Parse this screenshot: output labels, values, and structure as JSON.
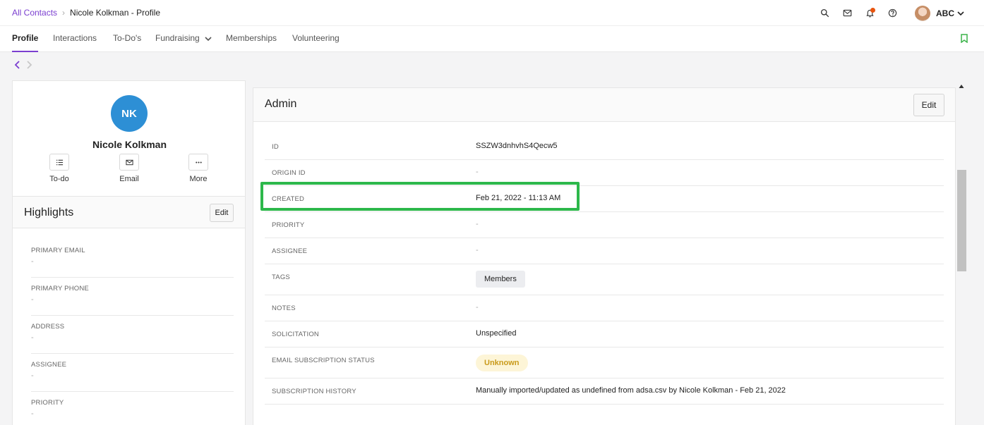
{
  "breadcrumb": {
    "parent": "All Contacts",
    "current": "Nicole Kolkman - Profile"
  },
  "header": {
    "account_label": "ABC",
    "icons": [
      "search-icon",
      "mail-icon",
      "bell-icon",
      "help-icon",
      "avatar",
      "chevron-down-icon"
    ],
    "notification_color": "#e8540e"
  },
  "tabs": [
    {
      "label": "Profile",
      "active": true
    },
    {
      "label": "Interactions"
    },
    {
      "label": "To-Do's"
    },
    {
      "label": "Fundraising"
    },
    {
      "label": "Memberships"
    },
    {
      "label": "Volunteering"
    }
  ],
  "contact": {
    "initials": "NK",
    "name": "Nicole Kolkman",
    "avatar_color": "#2d8fd5",
    "actions": [
      {
        "label": "To-do",
        "icon": "todo-list-icon"
      },
      {
        "label": "Email",
        "icon": "mail-icon"
      },
      {
        "label": "More",
        "icon": "more-icon"
      }
    ]
  },
  "highlights": {
    "title": "Highlights",
    "edit_label": "Edit",
    "fields": [
      {
        "label": "PRIMARY EMAIL",
        "value": "-"
      },
      {
        "label": "PRIMARY PHONE",
        "value": "-"
      },
      {
        "label": "ADDRESS",
        "value": "-"
      },
      {
        "label": "ASSIGNEE",
        "value": "-"
      },
      {
        "label": "PRIORITY",
        "value": "-"
      }
    ]
  },
  "admin": {
    "title": "Admin",
    "edit_label": "Edit",
    "rows": [
      {
        "label": "ID",
        "value": "SSZW3dnhvhS4Qecw5"
      },
      {
        "label": "ORIGIN ID",
        "value": "-"
      },
      {
        "label": "CREATED",
        "value": "Feb 21, 2022 - 11:13 AM"
      },
      {
        "label": "PRIORITY",
        "value": "-"
      },
      {
        "label": "ASSIGNEE",
        "value": "-"
      },
      {
        "label": "TAGS",
        "value": "Members"
      },
      {
        "label": "NOTES",
        "value": "-"
      },
      {
        "label": "SOLICITATION",
        "value": "Unspecified"
      },
      {
        "label": "EMAIL SUBSCRIPTION STATUS",
        "value": "Unknown"
      },
      {
        "label": "SUBSCRIPTION HISTORY",
        "value": "Manually imported/updated as undefined from adsa.csv by Nicole Kolkman - Feb 21, 2022"
      }
    ]
  },
  "colors": {
    "accent": "#7b3fd0",
    "highlight_box": "#2db84b",
    "unknown_pill_bg": "#fdf5d7",
    "unknown_pill_text": "#c99a1a"
  }
}
